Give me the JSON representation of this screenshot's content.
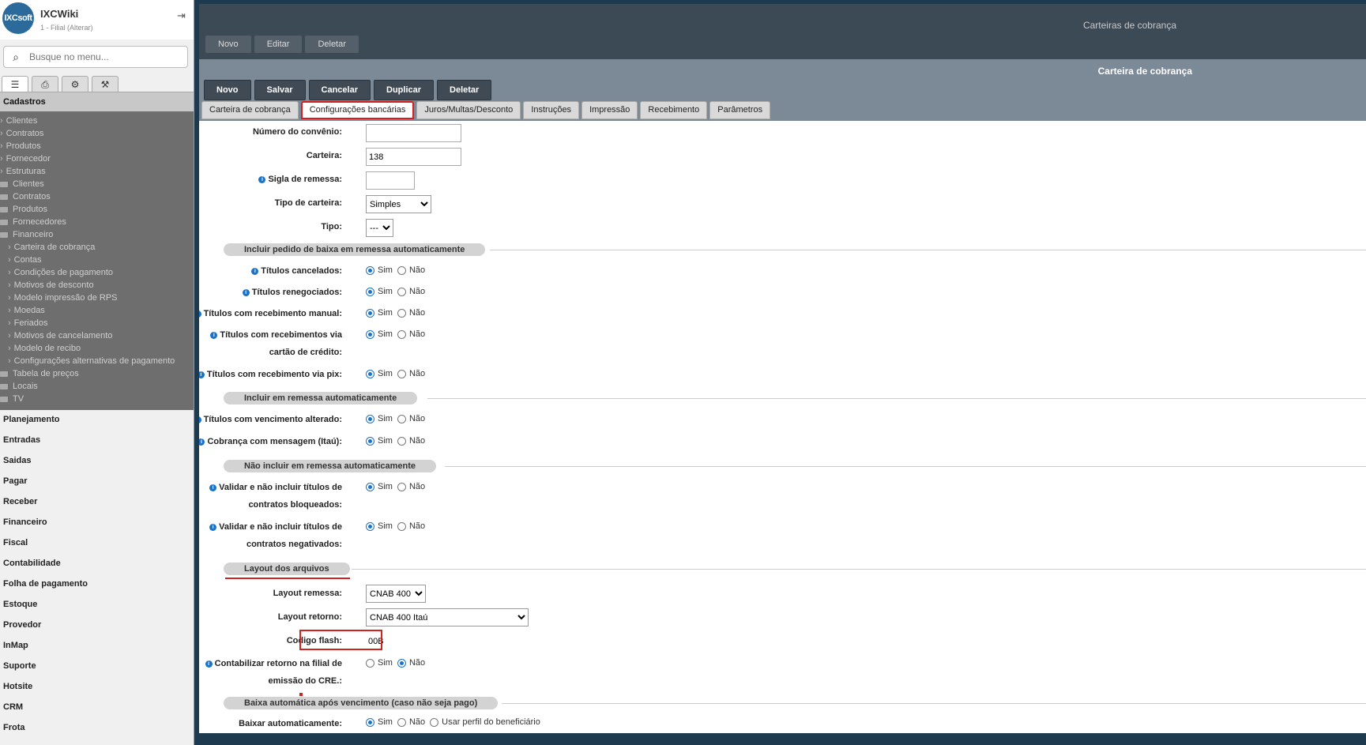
{
  "sidebar": {
    "app_name": "IXCWiki",
    "filial": "1 - Filial (Alterar)",
    "logo_text": "IXCsoft",
    "search_placeholder": "Busque no menu...",
    "tabs": [
      "list-icon",
      "print-icon",
      "settings-icon",
      "wrench-icon"
    ],
    "tree_title": "Cadastros",
    "tree": [
      {
        "label": "Clientes",
        "type": "leaf"
      },
      {
        "label": "Contratos",
        "type": "leaf"
      },
      {
        "label": "Produtos",
        "type": "leaf"
      },
      {
        "label": "Fornecedor",
        "type": "leaf"
      },
      {
        "label": "Estruturas",
        "type": "leaf"
      },
      {
        "label": "Clientes",
        "type": "folder"
      },
      {
        "label": "Contratos",
        "type": "folder"
      },
      {
        "label": "Produtos",
        "type": "folder"
      },
      {
        "label": "Fornecedores",
        "type": "folder"
      },
      {
        "label": "Financeiro",
        "type": "folder-open"
      },
      {
        "label": "Carteira de cobrança",
        "type": "child"
      },
      {
        "label": "Contas",
        "type": "child"
      },
      {
        "label": "Condições de pagamento",
        "type": "child"
      },
      {
        "label": "Motivos de desconto",
        "type": "child"
      },
      {
        "label": "Modelo impressão de RPS",
        "type": "child"
      },
      {
        "label": "Moedas",
        "type": "child"
      },
      {
        "label": "Feriados",
        "type": "child"
      },
      {
        "label": "Motivos de cancelamento",
        "type": "child"
      },
      {
        "label": "Modelo de recibo",
        "type": "child"
      },
      {
        "label": "Configurações alternativas de pagamento",
        "type": "child"
      },
      {
        "label": "Tabela de preços",
        "type": "folder"
      },
      {
        "label": "Locais",
        "type": "folder"
      },
      {
        "label": "TV",
        "type": "folder"
      }
    ],
    "menu": [
      "Planejamento",
      "Entradas",
      "Saidas",
      "Pagar",
      "Receber",
      "Financeiro",
      "Fiscal",
      "Contabilidade",
      "Folha de pagamento",
      "Estoque",
      "Provedor",
      "InMap",
      "Suporte",
      "Hotsite",
      "CRM",
      "Frota"
    ]
  },
  "bg_window": {
    "title": "Carteiras de cobrança",
    "buttons": [
      "Novo",
      "Editar",
      "Deletar"
    ]
  },
  "main_window": {
    "title": "Carteira de cobrança",
    "buttons": [
      "Novo",
      "Salvar",
      "Cancelar",
      "Duplicar",
      "Deletar"
    ],
    "tabs": [
      "Carteira de cobrança",
      "Configurações bancárias",
      "Juros/Multas/Desconto",
      "Instruções",
      "Impressão",
      "Recebimento",
      "Parâmetros"
    ],
    "active_tab": "Configurações bancárias"
  },
  "form": {
    "numero_convenio": {
      "label": "Número do convênio:",
      "value": ""
    },
    "carteira": {
      "label": "Carteira:",
      "value": "138"
    },
    "sigla_remessa": {
      "label": "Sigla de remessa:",
      "value": ""
    },
    "tipo_carteira": {
      "label": "Tipo de carteira:",
      "value": "Simples"
    },
    "tipo": {
      "label": "Tipo:",
      "value": "---"
    },
    "sim": "Sim",
    "nao": "Não",
    "section1": "Incluir pedido de baixa em remessa automaticamente",
    "titulos_cancelados": "Títulos cancelados:",
    "titulos_renegociados": "Títulos renegociados:",
    "titulos_receb_manual": "Títulos com recebimento manual:",
    "titulos_receb_cartao_1": "Títulos com recebimentos via",
    "titulos_receb_cartao_2": "cartão de crédito:",
    "titulos_receb_pix": "Títulos com recebimento via pix:",
    "section2": "Incluir em remessa automaticamente",
    "titulos_venc_alterado": "Títulos com vencimento alterado:",
    "cobranca_mensagem": "Cobrança com mensagem (Itaú):",
    "section3": "Não incluir em remessa automaticamente",
    "validar_bloqueados_1": "Validar e não incluir títulos de",
    "validar_bloqueados_2": "contratos bloqueados:",
    "validar_negativados_1": "Validar e não incluir títulos de",
    "validar_negativados_2": "contratos negativados:",
    "section4": "Layout dos arquivos",
    "layout_remessa": {
      "label": "Layout remessa:",
      "value": "CNAB 400"
    },
    "layout_retorno": {
      "label": "Layout retorno:",
      "value": "CNAB 400 Itaú"
    },
    "codigo_flash": {
      "label": "Codigo flash:",
      "value": "00B"
    },
    "contabilizar_1": "Contabilizar retorno na filial de",
    "contabilizar_2": "emissão do CRE.:",
    "section5": "Baixa automática após vencimento (caso não seja pago)",
    "baixar_auto": "Baixar automaticamente:",
    "usar_perfil": "Usar perfil do beneficiário"
  }
}
